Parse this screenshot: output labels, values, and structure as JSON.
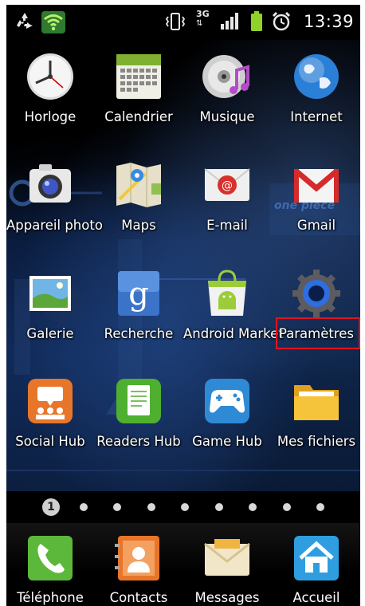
{
  "status_bar": {
    "time": "13:39",
    "left_icons": [
      "recycle-icon",
      "wifi-icon"
    ],
    "right_icons": [
      "vibrate-icon",
      "3g-icon",
      "signal-icon",
      "battery-icon",
      "alarm-icon"
    ],
    "network_label": "3G"
  },
  "apps": [
    {
      "label": "Horloge",
      "icon": "clock-icon"
    },
    {
      "label": "Calendrier",
      "icon": "calendar-icon"
    },
    {
      "label": "Musique",
      "icon": "music-icon"
    },
    {
      "label": "Internet",
      "icon": "globe-icon"
    },
    {
      "label": "Appareil photo",
      "icon": "camera-icon"
    },
    {
      "label": "Maps",
      "icon": "maps-icon"
    },
    {
      "label": "E-mail",
      "icon": "email-icon"
    },
    {
      "label": "Gmail",
      "icon": "gmail-icon"
    },
    {
      "label": "Galerie",
      "icon": "gallery-icon"
    },
    {
      "label": "Recherche",
      "icon": "search-icon"
    },
    {
      "label": "Android Market",
      "icon": "market-icon"
    },
    {
      "label": "Paramètres",
      "icon": "settings-gear-icon",
      "highlighted": true
    },
    {
      "label": "Social Hub",
      "icon": "social-hub-icon"
    },
    {
      "label": "Readers Hub",
      "icon": "readers-hub-icon"
    },
    {
      "label": "Game Hub",
      "icon": "game-hub-icon"
    },
    {
      "label": "Mes fichiers",
      "icon": "folder-icon"
    }
  ],
  "pager": {
    "current": "1",
    "page_count": 9
  },
  "dock": [
    {
      "label": "Téléphone",
      "icon": "phone-icon"
    },
    {
      "label": "Contacts",
      "icon": "contacts-icon"
    },
    {
      "label": "Messages",
      "icon": "messages-icon"
    },
    {
      "label": "Accueil",
      "icon": "home-icon"
    }
  ],
  "wallpaper_text": "one piece",
  "colors": {
    "highlight": "#e0141e",
    "background": "#000000"
  }
}
